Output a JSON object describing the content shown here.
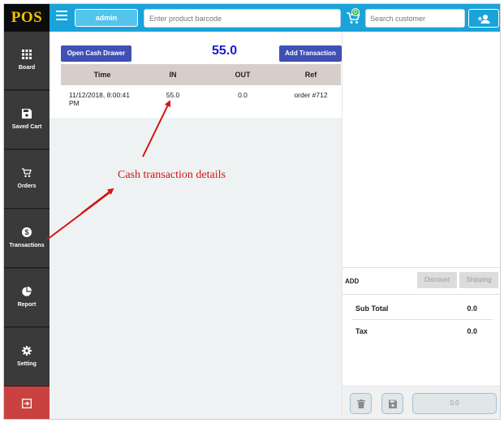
{
  "app": {
    "logo": "POS",
    "user": "admin",
    "barcode_placeholder": "Enter product barcode",
    "cart_count": "0",
    "customer_placeholder": "Search customer"
  },
  "sidebar": {
    "items": [
      {
        "label": "Board",
        "icon": "grid-icon"
      },
      {
        "label": "Saved Cart",
        "icon": "save-icon"
      },
      {
        "label": "Orders",
        "icon": "cart-icon"
      },
      {
        "label": "Transactions",
        "icon": "dollar-icon"
      },
      {
        "label": "Report",
        "icon": "pie-chart-icon"
      },
      {
        "label": "Setting",
        "icon": "gear-icon"
      }
    ],
    "logout_icon": "logout-icon"
  },
  "main": {
    "open_drawer_label": "Open Cash Drawer",
    "cash_amount": "55.0",
    "add_transaction_label": "Add Transaction",
    "table": {
      "headers": [
        "Time",
        "IN",
        "OUT",
        "Ref"
      ],
      "rows": [
        [
          "11/12/2018, 8:00:41 PM",
          "55.0",
          "0.0",
          "order #712"
        ]
      ]
    }
  },
  "cart": {
    "add_label": "ADD",
    "discount_label": "Discount",
    "shipping_label": "Shipping",
    "subtotal_label": "Sub Total",
    "subtotal_value": "0.0",
    "tax_label": "Tax",
    "tax_value": "0.0",
    "pay_value": "0.0"
  },
  "annotation": {
    "text": "Cash transaction details",
    "color": "#d21414"
  },
  "colors": {
    "accent": "#1aa3d9",
    "primary_button": "#3f51b5",
    "sidebar": "#3a3a3a",
    "logout": "#c9423f",
    "amount": "#1a1ad6"
  }
}
